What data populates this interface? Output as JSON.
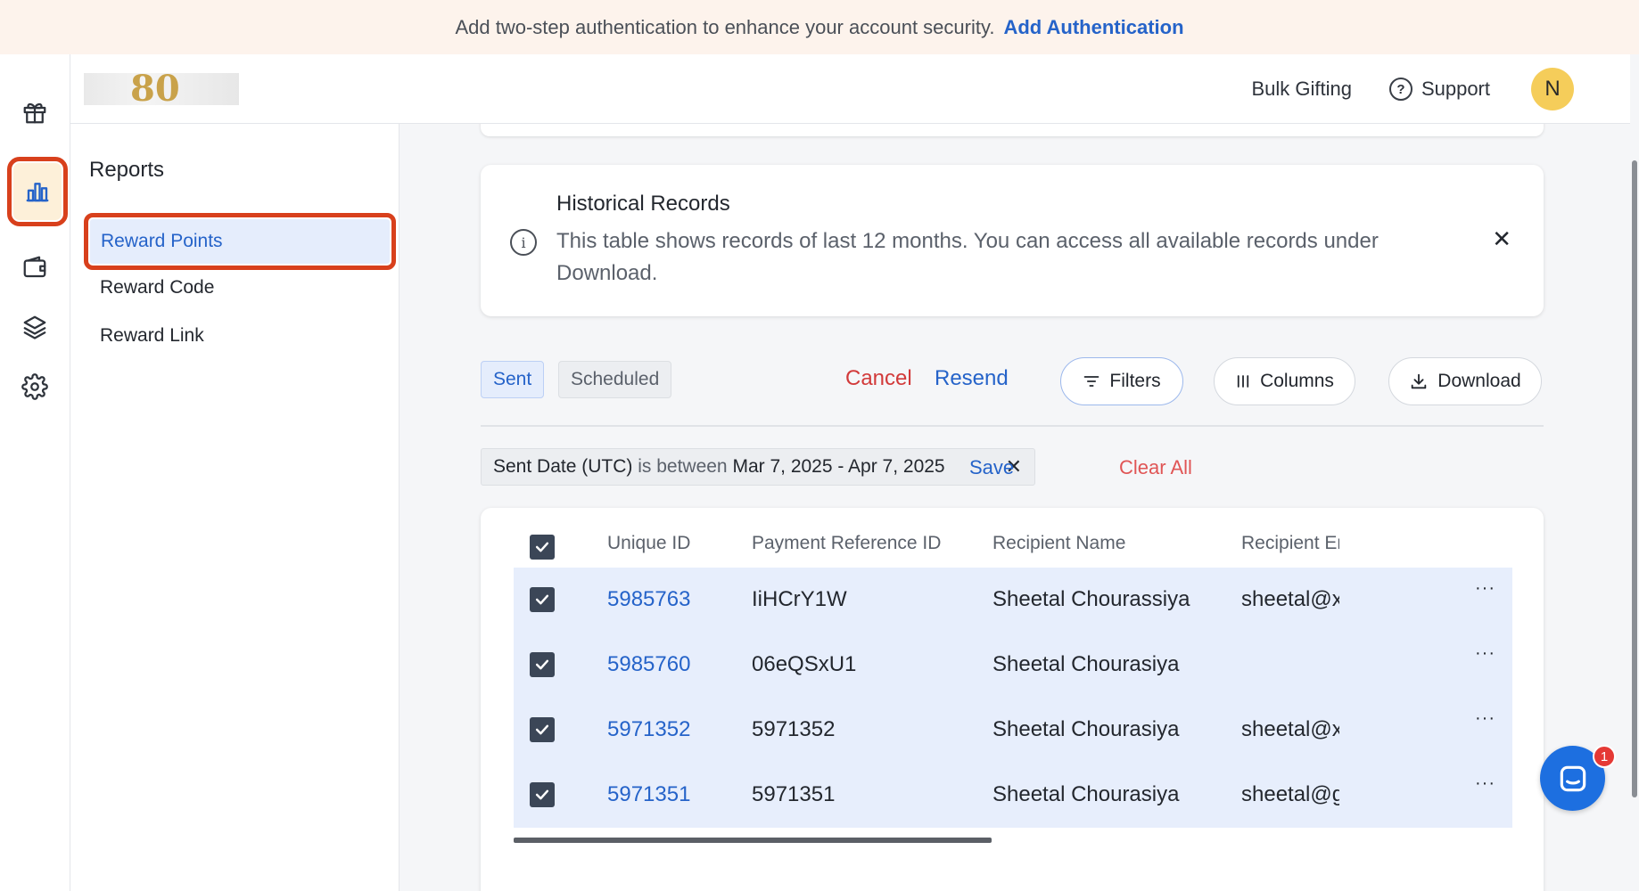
{
  "banner": {
    "text": "Add two-step authentication to enhance your account security.",
    "link": "Add Authentication"
  },
  "header": {
    "logo_text": "80",
    "bulk_gifting": "Bulk Gifting",
    "support": "Support",
    "help_glyph": "?",
    "avatar_initial": "N"
  },
  "rail": {
    "items": [
      "gift-icon",
      "chart-icon",
      "wallet-icon",
      "layers-icon",
      "gear-icon"
    ],
    "active_index": 1,
    "accent": "#d8401c"
  },
  "sidebar": {
    "title": "Reports",
    "items": [
      {
        "label": "Reward Points",
        "active": true
      },
      {
        "label": "Reward Code",
        "active": false
      },
      {
        "label": "Reward Link",
        "active": false
      }
    ]
  },
  "info": {
    "title": "Historical Records",
    "text": "This table shows records of last 12 months. You can access all available records under Download.",
    "close": "✕"
  },
  "toolbar": {
    "tabs": {
      "sent": "Sent",
      "scheduled": "Scheduled"
    },
    "cancel": "Cancel",
    "resend": "Resend",
    "filters": "Filters",
    "columns": "Columns",
    "download": "Download"
  },
  "filter": {
    "field": "Sent Date (UTC)",
    "operator": "is between",
    "value": "Mar 7, 2025 - Apr 7, 2025",
    "remove": "✕",
    "save": "Save",
    "clear_all": "Clear All"
  },
  "table": {
    "columns": [
      "Unique ID",
      "Payment Reference ID",
      "Recipient Name",
      "Recipient Er"
    ],
    "rows": [
      {
        "id": "5985763",
        "payment_ref": "IiHCrY1W",
        "name": "Sheetal Chourassiya",
        "email": "sheetal@x",
        "checked": true
      },
      {
        "id": "5985760",
        "payment_ref": "06eQSxU1",
        "name": "Sheetal Chourasiya",
        "email": "",
        "checked": true
      },
      {
        "id": "5971352",
        "payment_ref": "5971352",
        "name": "Sheetal Chourasiya",
        "email": "sheetal@x",
        "checked": true
      },
      {
        "id": "5971351",
        "payment_ref": "5971351",
        "name": "Sheetal Chourasiya",
        "email": "sheetal@g",
        "checked": true
      }
    ],
    "row_menu": "···"
  },
  "chat": {
    "badge": "1"
  },
  "colors": {
    "link": "#2563c9",
    "danger": "#d23a3a",
    "selected_row": "#e7eefc",
    "banner_bg": "#fdf3ec"
  }
}
